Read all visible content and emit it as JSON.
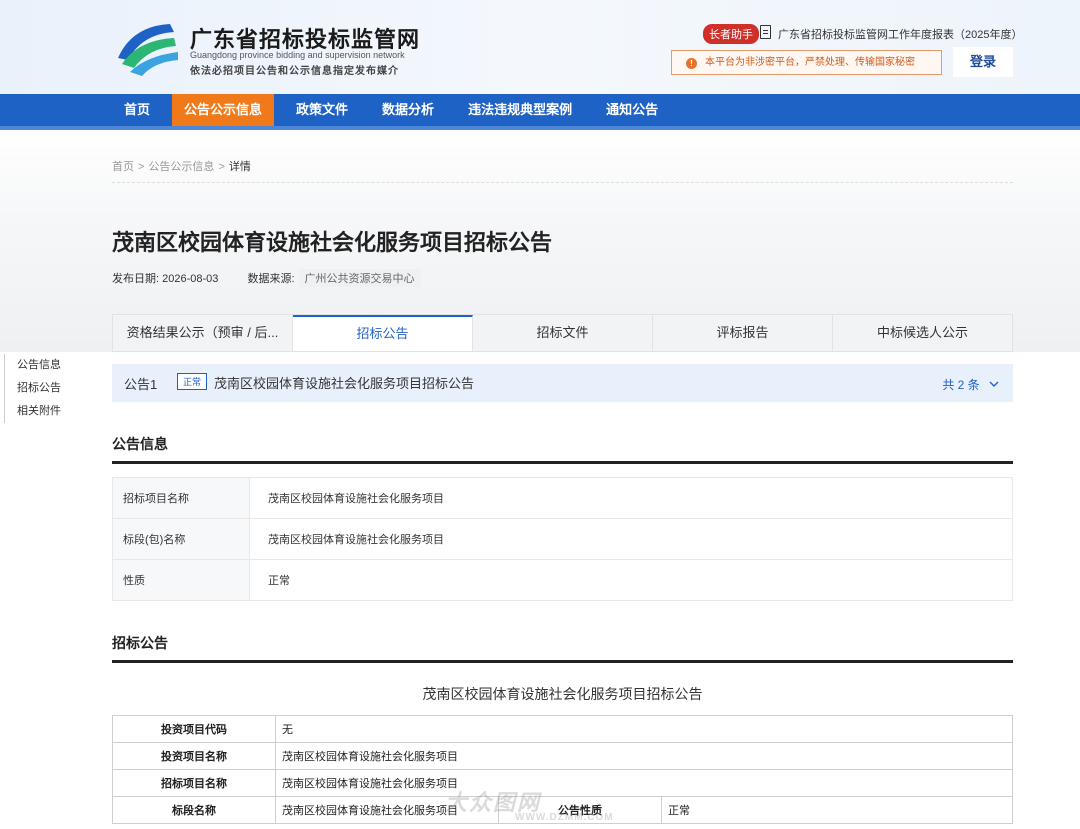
{
  "header": {
    "site_title": "广东省招标投标监管网",
    "site_en": "Guangdong province bidding and supervision network",
    "site_sub": "依法必招项目公告和公示信息指定发布媒介",
    "elder_badge": "长者助手",
    "report_link": "广东省招标投标监管网工作年度报表（2025年度）",
    "notice": "本平台为非涉密平台，严禁处理、传输国家秘密",
    "login": "登录"
  },
  "nav": [
    "首页",
    "公告公示信息",
    "政策文件",
    "数据分析",
    "违法违规典型案例",
    "通知公告"
  ],
  "breadcrumb": {
    "home": "首页",
    "parent": "公告公示信息",
    "current": "详情",
    "sep": ">"
  },
  "page": {
    "title": "茂南区校园体育设施社会化服务项目招标公告",
    "date_label": "发布日期:",
    "date": "2026-08-03",
    "source_label": "数据来源:",
    "source": "广州公共资源交易中心"
  },
  "tabs": [
    "资格结果公示（预审 / 后...",
    "招标公告",
    "招标文件",
    "评标报告",
    "中标候选人公示"
  ],
  "side_nav": [
    "公告信息",
    "招标公告",
    "相关附件"
  ],
  "announcement": {
    "label": "公告1",
    "tag": "正常",
    "name": "茂南区校园体育设施社会化服务项目招标公告",
    "count": "共 2 条"
  },
  "info_section": {
    "title": "公告信息",
    "rows": [
      {
        "k": "招标项目名称",
        "v": "茂南区校园体育设施社会化服务项目"
      },
      {
        "k": "标段(包)名称",
        "v": "茂南区校园体育设施社会化服务项目"
      },
      {
        "k": "性质",
        "v": "正常"
      }
    ]
  },
  "bid_section": {
    "title": "招标公告",
    "doc_title": "茂南区校园体育设施社会化服务项目招标公告",
    "rows": [
      {
        "k": "投资项目代码",
        "v": "无"
      },
      {
        "k": "投资项目名称",
        "v": "茂南区校园体育设施社会化服务项目"
      },
      {
        "k": "招标项目名称",
        "v": "茂南区校园体育设施社会化服务项目"
      },
      {
        "k": "标段名称",
        "v": "茂南区校园体育设施社会化服务项目",
        "k2": "公告性质",
        "v2": "正常"
      }
    ]
  },
  "watermark": {
    "text": "大众图网",
    "url": "WWW.DZMM.COM"
  },
  "colors": {
    "nav_bg": "#1f62c5",
    "nav_active": "#f07a1a",
    "accent": "#1f62c5",
    "elder_badge": "#d0302a"
  }
}
